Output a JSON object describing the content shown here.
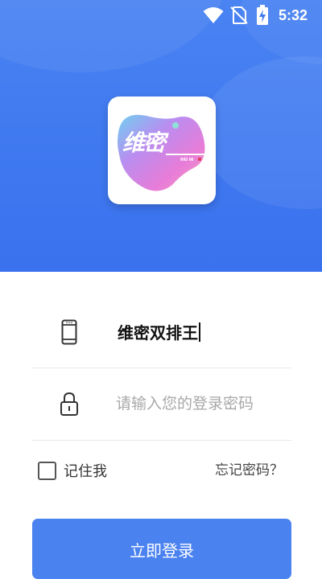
{
  "status_bar": {
    "time": "5:32",
    "icons": [
      "wifi-icon",
      "no-sim-icon",
      "battery-charging-icon"
    ]
  },
  "logo": {
    "text": "维密",
    "subtext": "WEI MI"
  },
  "form": {
    "account_value": "维密双排王",
    "password_placeholder": "请输入您的登录密码",
    "password_value": "",
    "remember_label": "记住我",
    "remember_checked": false,
    "forgot_label": "忘记密码？",
    "login_label": "立即登录"
  },
  "colors": {
    "header_blue": "#4a83f2",
    "button_blue": "#4a82f0",
    "placeholder_gray": "#a8a8a8",
    "divider": "#e8e8e8"
  }
}
